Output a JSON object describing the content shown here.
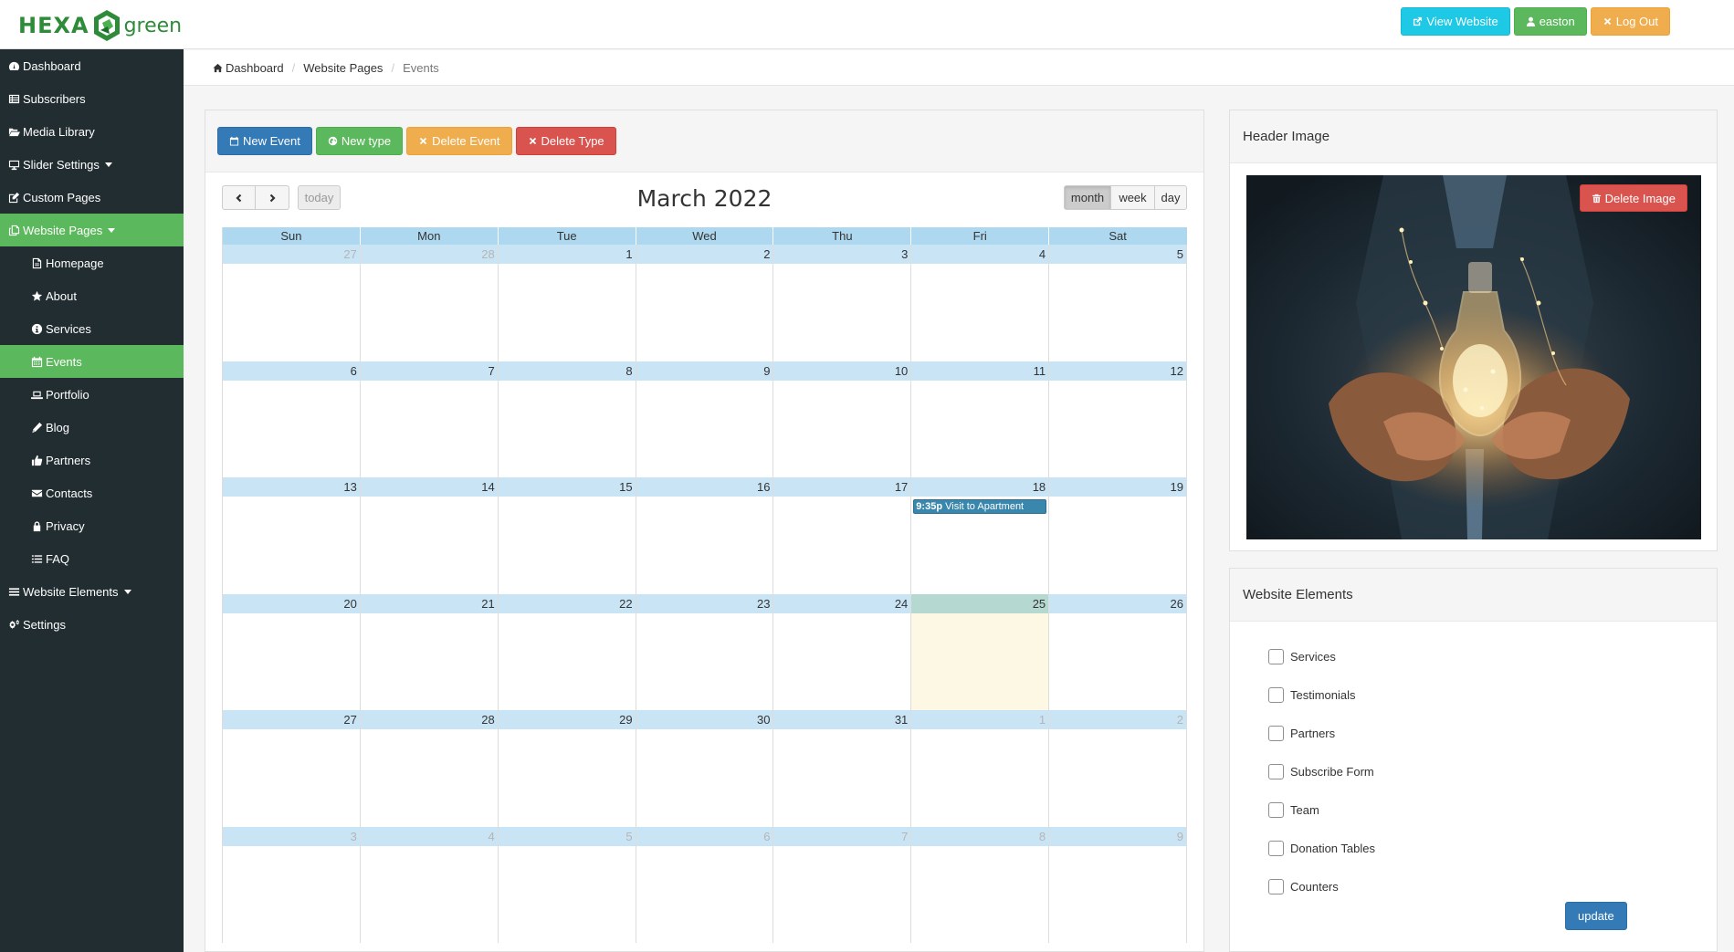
{
  "brand": {
    "name_left": "HEXA",
    "name_right": "green",
    "color": "#2e8b3a"
  },
  "topbar": {
    "view_website": "View Website",
    "user": "easton",
    "logout": "Log Out"
  },
  "sidebar": {
    "items": [
      {
        "label": "Dashboard",
        "icon": "dashboard-icon"
      },
      {
        "label": "Subscribers",
        "icon": "list-icon"
      },
      {
        "label": "Media Library",
        "icon": "folder-open-icon"
      },
      {
        "label": "Slider Settings",
        "icon": "desktop-icon"
      },
      {
        "label": "Custom Pages",
        "icon": "edit-icon"
      },
      {
        "label": "Website Pages",
        "icon": "copy-icon"
      },
      {
        "label": "Homepage",
        "icon": "file-icon"
      },
      {
        "label": "About",
        "icon": "star-icon"
      },
      {
        "label": "Services",
        "icon": "info-circle-icon"
      },
      {
        "label": "Events",
        "icon": "calendar-icon"
      },
      {
        "label": "Portfolio",
        "icon": "laptop-icon"
      },
      {
        "label": "Blog",
        "icon": "pencil-icon"
      },
      {
        "label": "Partners",
        "icon": "thumbs-up-icon"
      },
      {
        "label": "Contacts",
        "icon": "envelope-icon"
      },
      {
        "label": "Privacy",
        "icon": "lock-icon"
      },
      {
        "label": "FAQ",
        "icon": "list-icon"
      },
      {
        "label": "Website Elements",
        "icon": "bars-icon"
      },
      {
        "label": "Settings",
        "icon": "cogs-icon"
      }
    ]
  },
  "breadcrumb": {
    "home": "Dashboard",
    "parent": "Website Pages",
    "current": "Events"
  },
  "toolbar": {
    "new_event": "New Event",
    "new_type": "New type",
    "delete_event": "Delete Event",
    "delete_type": "Delete Type"
  },
  "calendar": {
    "title": "March 2022",
    "today_label": "today",
    "views": {
      "month": "month",
      "week": "week",
      "day": "day"
    },
    "active_view": "month",
    "weekdays": [
      "Sun",
      "Mon",
      "Tue",
      "Wed",
      "Thu",
      "Fri",
      "Sat"
    ],
    "weeks": [
      [
        {
          "d": "27",
          "other": true
        },
        {
          "d": "28",
          "other": true
        },
        {
          "d": "1"
        },
        {
          "d": "2"
        },
        {
          "d": "3"
        },
        {
          "d": "4"
        },
        {
          "d": "5"
        }
      ],
      [
        {
          "d": "6"
        },
        {
          "d": "7"
        },
        {
          "d": "8"
        },
        {
          "d": "9"
        },
        {
          "d": "10"
        },
        {
          "d": "11"
        },
        {
          "d": "12"
        }
      ],
      [
        {
          "d": "13"
        },
        {
          "d": "14"
        },
        {
          "d": "15"
        },
        {
          "d": "16"
        },
        {
          "d": "17"
        },
        {
          "d": "18",
          "event": {
            "time": "9:35p",
            "title": "Visit to Apartment"
          }
        },
        {
          "d": "19"
        }
      ],
      [
        {
          "d": "20"
        },
        {
          "d": "21"
        },
        {
          "d": "22"
        },
        {
          "d": "23"
        },
        {
          "d": "24"
        },
        {
          "d": "25",
          "today": true
        },
        {
          "d": "26"
        }
      ],
      [
        {
          "d": "27"
        },
        {
          "d": "28"
        },
        {
          "d": "29"
        },
        {
          "d": "30"
        },
        {
          "d": "31"
        },
        {
          "d": "1",
          "other": true
        },
        {
          "d": "2",
          "other": true
        }
      ],
      [
        {
          "d": "3",
          "other": true
        },
        {
          "d": "4",
          "other": true
        },
        {
          "d": "5",
          "other": true
        },
        {
          "d": "6",
          "other": true
        },
        {
          "d": "7",
          "other": true
        },
        {
          "d": "8",
          "other": true
        },
        {
          "d": "9",
          "other": true
        }
      ]
    ]
  },
  "header_image": {
    "title": "Header Image",
    "delete_label": "Delete Image"
  },
  "website_elements": {
    "title": "Website Elements",
    "items": [
      {
        "label": "Services",
        "checked": false
      },
      {
        "label": "Testimonials",
        "checked": false
      },
      {
        "label": "Partners",
        "checked": false
      },
      {
        "label": "Subscribe Form",
        "checked": false
      },
      {
        "label": "Team",
        "checked": false
      },
      {
        "label": "Donation Tables",
        "checked": false
      },
      {
        "label": "Counters",
        "checked": false
      }
    ],
    "update_label": "update"
  },
  "colors": {
    "sidebar_bg": "#222d32",
    "active_green": "#5cb85c",
    "info": "#1ec9e6",
    "warning": "#f0ad4e",
    "danger": "#d9534f",
    "primary": "#337ab7",
    "event_blue": "#3a87ad"
  }
}
